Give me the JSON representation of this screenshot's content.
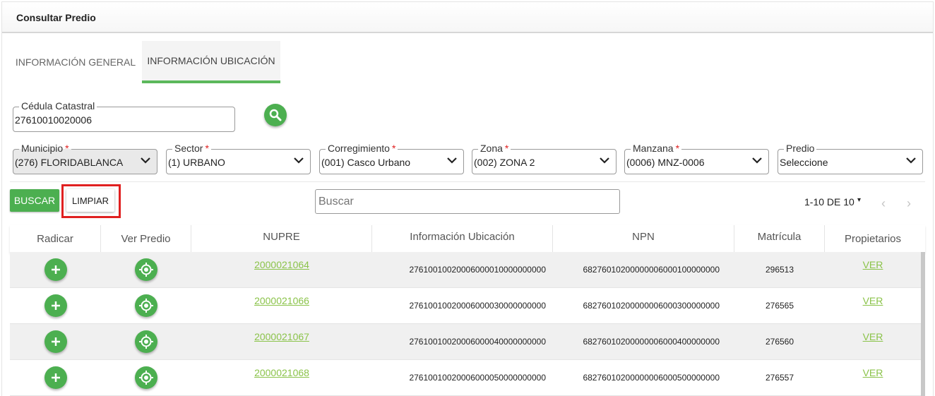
{
  "header": {
    "title": "Consultar Predio"
  },
  "tabs": [
    {
      "label": "INFORMACIÓN GENERAL"
    },
    {
      "label": "INFORMACIÓN UBICACIÓN"
    }
  ],
  "cedula": {
    "label": "Cédula Catastral",
    "value": "27610010020006"
  },
  "filters": {
    "municipio": {
      "label": "Municipio",
      "value": "(276) FLORIDABLANCA",
      "required": "*"
    },
    "sector": {
      "label": "Sector",
      "value": "(1) URBANO",
      "required": "*"
    },
    "corregimiento": {
      "label": "Corregimiento",
      "value": "(001) Casco Urbano",
      "required": "*"
    },
    "zona": {
      "label": "Zona",
      "value": "(002) ZONA 2",
      "required": "*"
    },
    "manzana": {
      "label": "Manzana",
      "value": "(0006) MNZ-0006",
      "required": "*"
    },
    "predio": {
      "label": "Predio",
      "value": "Seleccione"
    }
  },
  "actions": {
    "buscar": "BUSCAR",
    "limpiar": "LIMPIAR"
  },
  "search": {
    "placeholder": "Buscar"
  },
  "pager": {
    "text": "1-10 DE 10",
    "caret": "▾",
    "prev": "‹",
    "next": "›"
  },
  "table": {
    "headers": [
      "Radicar",
      "Ver Predio",
      "NUPRE",
      "Información Ubicación",
      "NPN",
      "Matrícula",
      "Propietarios"
    ],
    "rows": [
      {
        "nupre": "2000021064",
        "ubicacion": "27610010020006000010000000000",
        "npn": "68276010200000006000100000000",
        "matricula": "296513",
        "propietarios": "VER"
      },
      {
        "nupre": "2000021066",
        "ubicacion": "27610010020006000030000000000",
        "npn": "68276010200000006000300000000",
        "matricula": "276565",
        "propietarios": "VER"
      },
      {
        "nupre": "2000021067",
        "ubicacion": "27610010020006000040000000000",
        "npn": "68276010200000006000400000000",
        "matricula": "276560",
        "propietarios": "VER"
      },
      {
        "nupre": "2000021068",
        "ubicacion": "27610010020006000050000000000",
        "npn": "68276010200000006000500000000",
        "matricula": "276557",
        "propietarios": "VER"
      }
    ]
  },
  "colors": {
    "accent": "#4caf50",
    "link": "#8bc34a",
    "highlight": "#e02020"
  }
}
